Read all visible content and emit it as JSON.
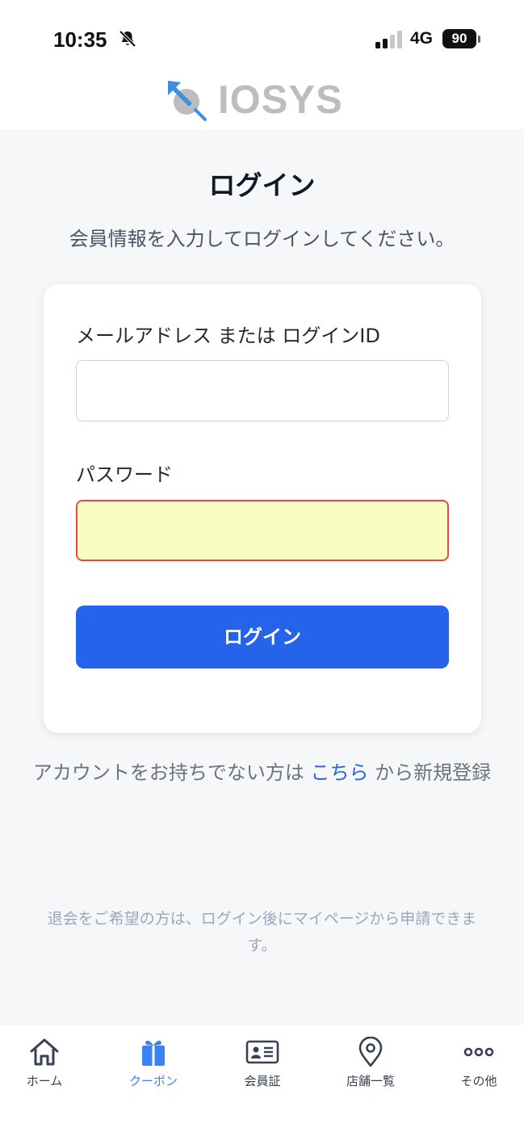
{
  "status_bar": {
    "time": "10:35",
    "network": "4G",
    "battery": "90"
  },
  "logo": {
    "text": "IOSYS"
  },
  "page": {
    "title": "ログイン",
    "subtitle": "会員情報を入力してログインしてください。"
  },
  "form": {
    "email_label": "メールアドレス または ログインID",
    "email_value": "",
    "password_label": "パスワード",
    "password_value": "",
    "login_button": "ログイン"
  },
  "register": {
    "prefix": "アカウントをお持ちでない方は",
    "link": "こちら",
    "suffix": "から新規登録"
  },
  "note": "退会をご希望の方は、ログイン後にマイページから申請できます。",
  "tabbar": {
    "items": [
      {
        "label": "ホーム",
        "icon": "home-icon"
      },
      {
        "label": "クーポン",
        "icon": "gift-icon",
        "active": true
      },
      {
        "label": "会員証",
        "icon": "member-card-icon"
      },
      {
        "label": "店舗一覧",
        "icon": "map-pin-icon"
      },
      {
        "label": "その他",
        "icon": "more-icon"
      }
    ]
  },
  "colors": {
    "primary": "#2563eb",
    "active_tab": "#3b82f6",
    "password_field_bg": "#fafdc1",
    "password_field_border": "#e54848"
  }
}
